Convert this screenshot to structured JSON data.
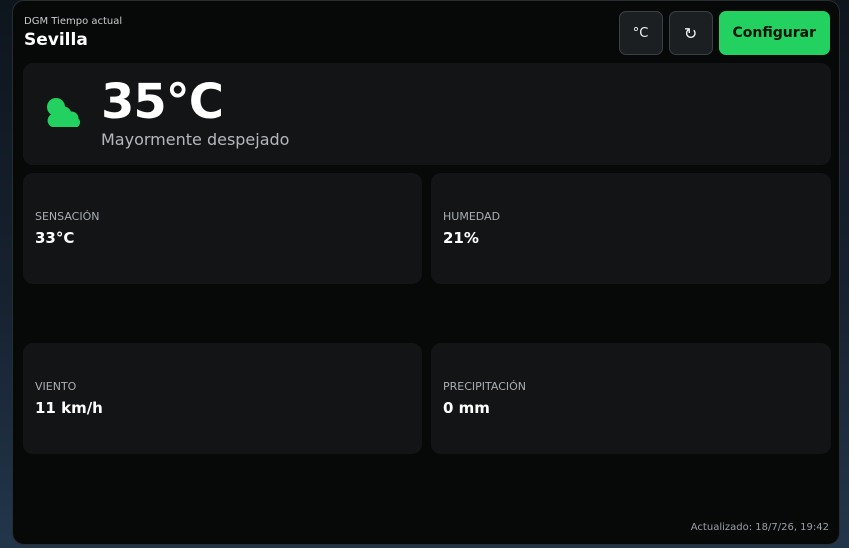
{
  "header": {
    "app_name": "DGM Tiempo actual",
    "location": "Sevilla"
  },
  "actions": {
    "unit_label": "°C",
    "refresh_label": "↻",
    "configure_label": "Configurar"
  },
  "current": {
    "icon": "partly-cloudy-icon",
    "temperature": "35°C",
    "description": "Mayormente despejado"
  },
  "stats": [
    {
      "label": "SENSACIÓN",
      "value": "33°C"
    },
    {
      "label": "HUMEDAD",
      "value": "21%"
    },
    {
      "label": "VIENTO",
      "value": "11 km/h"
    },
    {
      "label": "PRECIPITACIÓN",
      "value": "0 mm"
    }
  ],
  "footer": {
    "updated": "Actualizado: 18/7/26, 19:42"
  },
  "colors": {
    "accent": "#22d160",
    "background": "#070808",
    "card": "#131416"
  }
}
